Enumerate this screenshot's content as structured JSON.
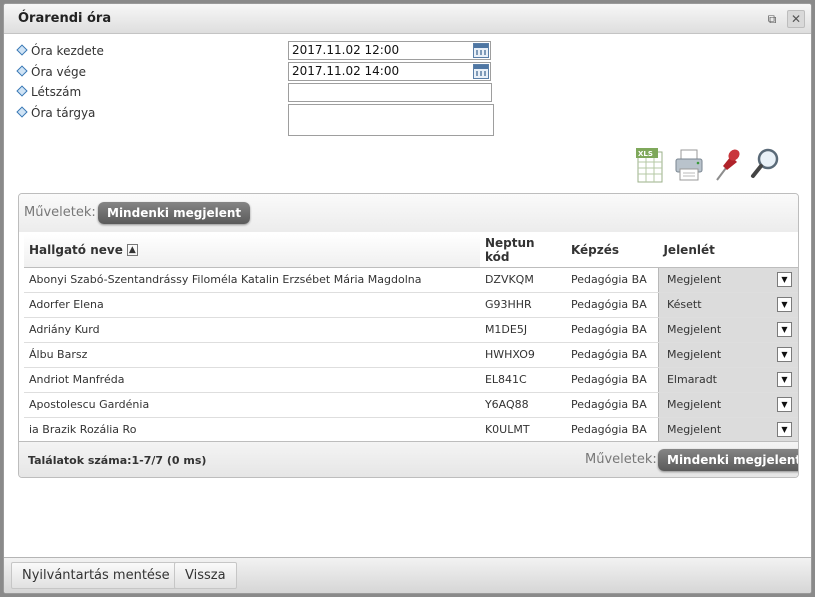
{
  "dialog": {
    "title": "Órarendi óra",
    "popout_glyph": "⧉",
    "close_glyph": "✕"
  },
  "form": {
    "start_label": "Óra kezdete",
    "start_value": "2017.11.02 12:00",
    "end_label": "Óra vége",
    "end_value": "2017.11.02 14:00",
    "headcount_label": "Létszám",
    "headcount_value": "",
    "subject_label": "Óra tárgya",
    "subject_value": ""
  },
  "toolbar_icons": [
    "xls-export-icon",
    "print-icon",
    "pin-icon",
    "search-magnifier-icon"
  ],
  "toolbar": {
    "xls_text": "XLS"
  },
  "grid": {
    "ops_label": "Műveletek:",
    "all_present_label": "Mindenki megjelent",
    "columns": {
      "name": "Hallgató neve",
      "sort_glyph": "▲",
      "neptun": "Neptun kód",
      "program": "Képzés",
      "attendance": "Jelenlét"
    },
    "arrow_glyph": "▼",
    "rows": [
      {
        "name": "Abonyi Szabó-Szentandrássy Filoméla Katalin Erzsébet Mária Magdolna",
        "neptun": "DZVKQM",
        "program": "Pedagógia BA",
        "attendance": "Megjelent"
      },
      {
        "name": "Adorfer Elena",
        "neptun": "G93HHR",
        "program": "Pedagógia BA",
        "attendance": "Késett"
      },
      {
        "name": "Adriány Kurd",
        "neptun": "M1DE5J",
        "program": "Pedagógia BA",
        "attendance": "Megjelent"
      },
      {
        "name": "Álbu Barsz",
        "neptun": "HWHXO9",
        "program": "Pedagógia BA",
        "attendance": "Megjelent"
      },
      {
        "name": "Andriot Manfréda",
        "neptun": "EL841C",
        "program": "Pedagógia BA",
        "attendance": "Elmaradt"
      },
      {
        "name": "Apostolescu Gardénia",
        "neptun": "Y6AQ88",
        "program": "Pedagógia BA",
        "attendance": "Megjelent"
      },
      {
        "name": "ia Brazik Rozália Ro",
        "neptun": "K0ULMT",
        "program": "Pedagógia BA",
        "attendance": "Megjelent"
      }
    ],
    "results_count": "Találatok száma:1-7/7 (0 ms)",
    "ops_label_bottom": "Műveletek:",
    "all_present_label_bottom": "Mindenki megjelent"
  },
  "footer": {
    "save_label": "Nyilvántartás mentése",
    "back_label": "Vissza"
  }
}
